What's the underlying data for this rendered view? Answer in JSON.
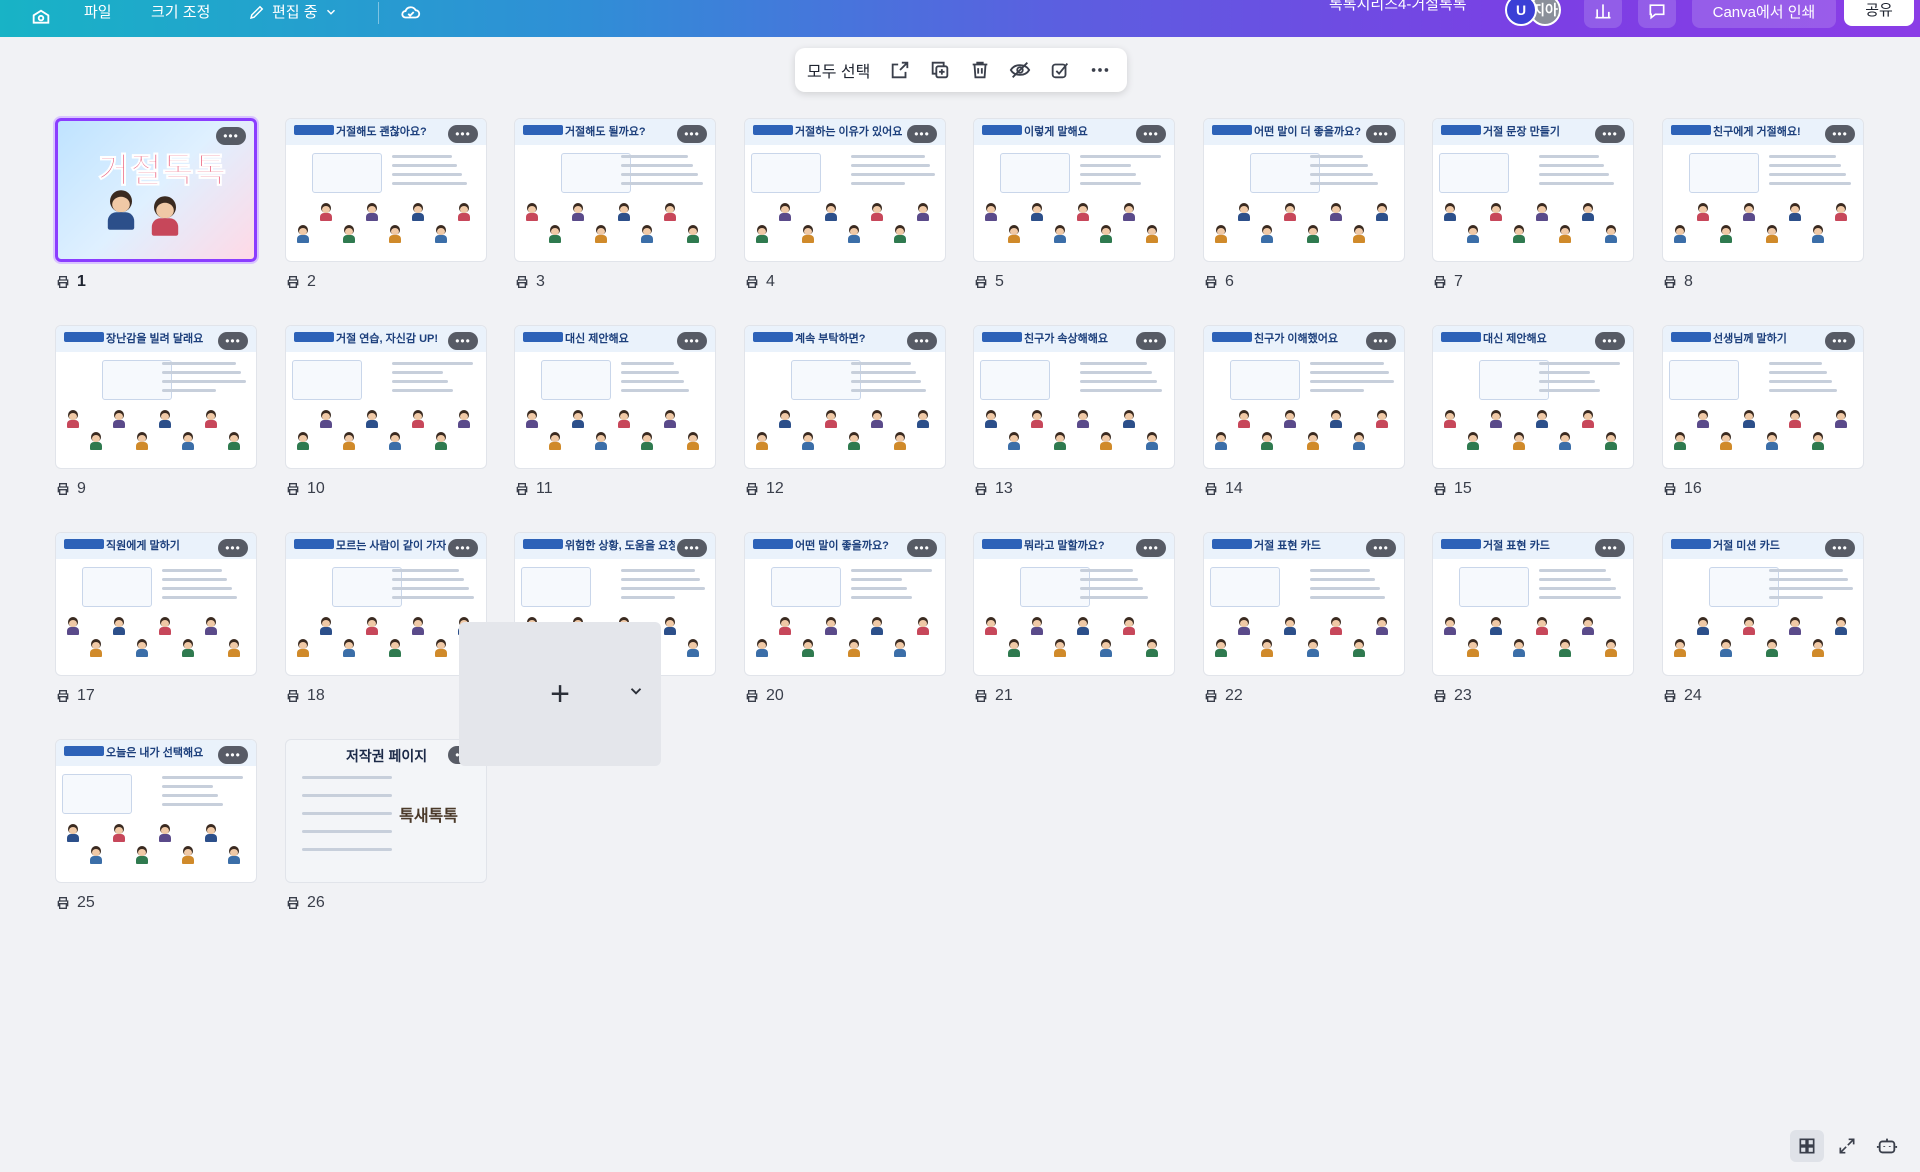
{
  "topbar": {
    "file": "파일",
    "resize": "크기 조정",
    "edit": "편집 중",
    "doc_title": "톡톡시리즈4-거절톡톡",
    "avatar_initial": "U",
    "avatar_other": "지아",
    "print_label": "Canva에서 인쇄",
    "share_label": "공유"
  },
  "selection_toolbar": {
    "select_all": "모두 선택"
  },
  "pages": [
    {
      "number": "1",
      "heading": "거절톡톡",
      "selected": true,
      "kind": "cover"
    },
    {
      "number": "2",
      "heading": "거절해도 괜찮아요?"
    },
    {
      "number": "3",
      "heading": "거절해도 될까요?"
    },
    {
      "number": "4",
      "heading": "거절하는 이유가 있어요"
    },
    {
      "number": "5",
      "heading": "이렇게 말해요"
    },
    {
      "number": "6",
      "heading": "어떤 말이 더 좋을까요?"
    },
    {
      "number": "7",
      "heading": "거절 문장 만들기"
    },
    {
      "number": "8",
      "heading": "친구에게 거절해요!"
    },
    {
      "number": "9",
      "heading": "장난감을 빌려 달래요"
    },
    {
      "number": "10",
      "heading": "거절 연습, 자신감 UP!"
    },
    {
      "number": "11",
      "heading": "대신 제안해요"
    },
    {
      "number": "12",
      "heading": "계속 부탁하면?"
    },
    {
      "number": "13",
      "heading": "친구가 속상해해요"
    },
    {
      "number": "14",
      "heading": "친구가 이해했어요"
    },
    {
      "number": "15",
      "heading": "대신 제안해요"
    },
    {
      "number": "16",
      "heading": "선생님께 말하기"
    },
    {
      "number": "17",
      "heading": "직원에게 말하기"
    },
    {
      "number": "18",
      "heading": "모르는 사람이 같이 가자고 해요"
    },
    {
      "number": "19",
      "heading": "위험한 상황, 도움을 요청해요!"
    },
    {
      "number": "20",
      "heading": "어떤 말이 좋을까요?"
    },
    {
      "number": "21",
      "heading": "뭐라고 말할까요?"
    },
    {
      "number": "22",
      "heading": "거절 표현 카드"
    },
    {
      "number": "23",
      "heading": "거절 표현 카드"
    },
    {
      "number": "24",
      "heading": "거절 미션 카드"
    },
    {
      "number": "25",
      "heading": "오늘은 내가 선택해요"
    },
    {
      "number": "26",
      "heading": "저작권 페이지",
      "kind": "copyright",
      "logo": "톡새톡톡"
    }
  ],
  "add_page": {
    "plus": "+"
  },
  "accent": "#8b3dff"
}
